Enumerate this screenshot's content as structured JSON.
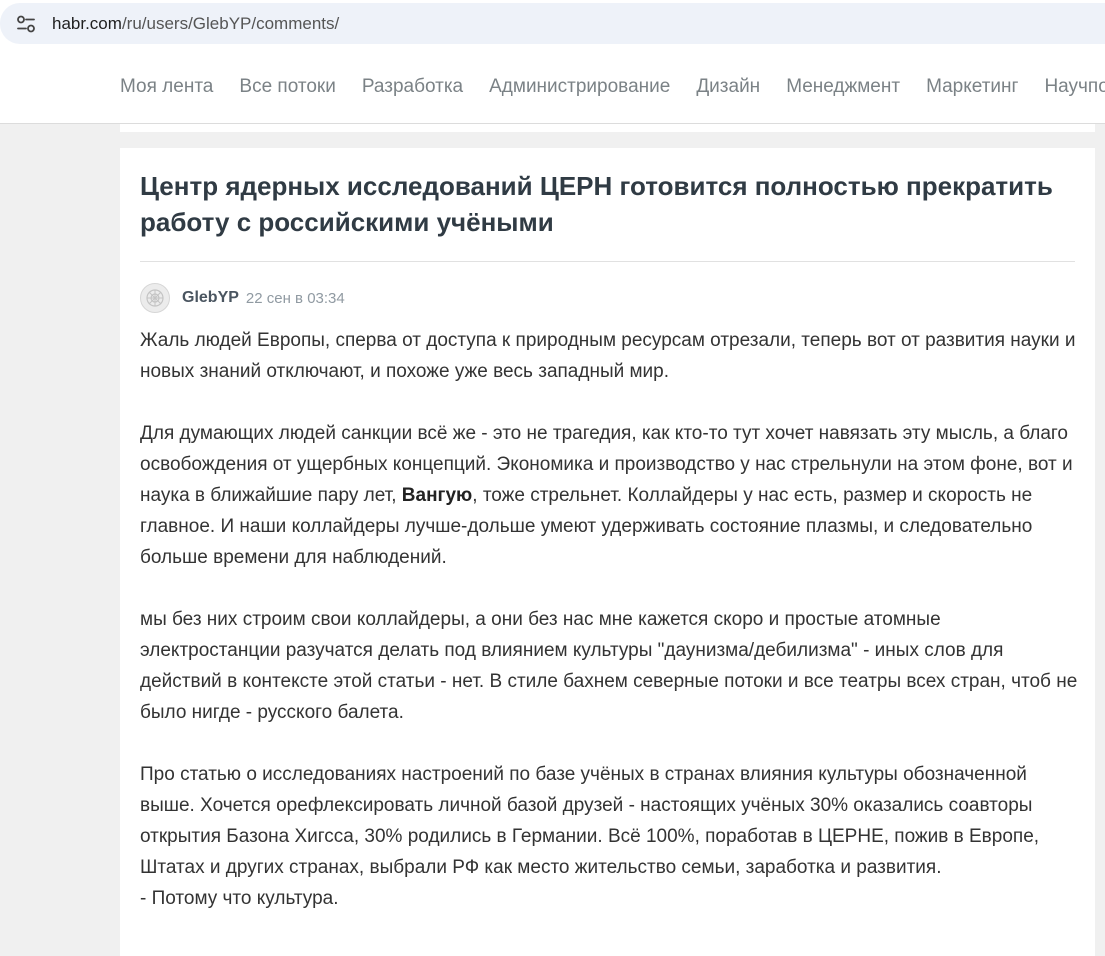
{
  "browser": {
    "url_host": "habr.com",
    "url_path": "/ru/users/GlebYP/comments/"
  },
  "nav": {
    "items": [
      "Моя лента",
      "Все потоки",
      "Разработка",
      "Администрирование",
      "Дизайн",
      "Менеджмент",
      "Маркетинг",
      "Научпоп"
    ]
  },
  "post": {
    "title": "Центр ядерных исследований ЦЕРН готовится полностью прекратить работу с российскими учёными"
  },
  "comment": {
    "author": "GlebYP",
    "timestamp": "22 сен в 03:34",
    "p1": "Жаль людей Европы, сперва от доступа к природным ресурсам отрезали, теперь вот от развития науки и новых знаний отключают, и похоже уже весь западный мир.",
    "p2_before": "Для думающих людей санкции всё же - это не трагедия, как кто-то тут хочет навязать эту мысль, а благо освобождения от ущербных концепций. Экономика и производство у нас стрельнули на этом фоне, вот и наука в ближайшие пару лет, ",
    "p2_bold": "Вангую",
    "p2_after": ", тоже стрельнет. Коллайдеры у нас есть, размер и скорость не главное. И наши коллайдеры лучше-дольше умеют удерживать состояние плазмы, и следовательно больше времени для наблюдений.",
    "p3": "мы без них строим свои коллайдеры, а они без нас мне кажется скоро и простые атомные электростанции разучатся делать под влиянием культуры \"даунизма/дебилизма\" - иных слов для действий в контексте этой статьи - нет. В стиле бахнем северные потоки и все театры всех стран, чтоб не было нигде - русского балета.",
    "p4": "Про статью о исследованиях настроений по базе учёных в странах влияния культуры обозначенной выше. Хочется орефлексировать личной базой друзей - настоящих учёных 30% оказались соавторы открытия Базона Хигсса, 30% родились в Германии. Всё 100%, поработав в ЦЕРНЕ, пожив в Европе, Штатах и других странах, выбрали РФ как место жительство семьи, заработка и развития.",
    "p5": "- Потому что культура."
  }
}
